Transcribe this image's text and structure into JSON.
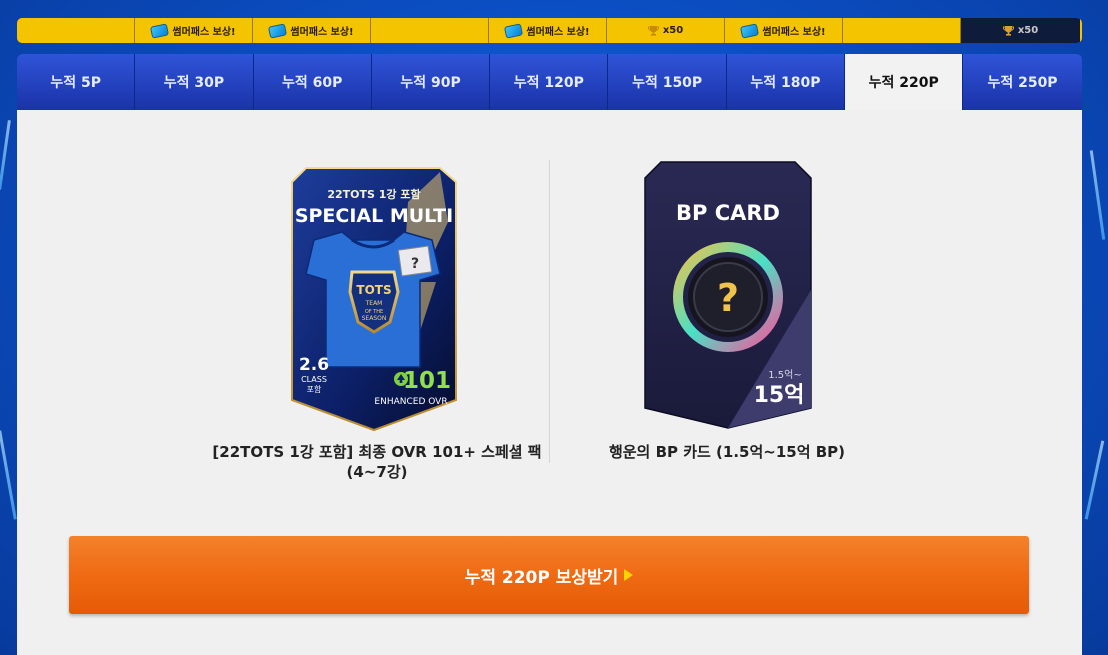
{
  "reward_strip": [
    {
      "type": "empty",
      "label": ""
    },
    {
      "type": "ticket",
      "label": "썸머패스 보상!"
    },
    {
      "type": "ticket",
      "label": "썸머패스 보상!"
    },
    {
      "type": "empty",
      "label": ""
    },
    {
      "type": "ticket",
      "label": "썸머패스 보상!"
    },
    {
      "type": "trophy",
      "label": "x50"
    },
    {
      "type": "ticket",
      "label": "썸머패스 보상!"
    },
    {
      "type": "empty",
      "label": ""
    },
    {
      "type": "trophy",
      "label": "x50",
      "locked": true
    }
  ],
  "tabs": [
    "누적 5P",
    "누적 30P",
    "누적 60P",
    "누적 90P",
    "누적 120P",
    "누적 150P",
    "누적 180P",
    "누적 220P",
    "누적 250P"
  ],
  "active_tab": "누적 220P",
  "rewards": [
    {
      "card_texts": {
        "subtitle": "22TOTS 1강 포함",
        "title": "SPECIAL MULTI",
        "badge_top": "TOTS",
        "badge_mid": "TEAM",
        "badge_of": "OF THE",
        "badge_bottom": "SEASON",
        "season_num": "2.6",
        "season_class": "CLASS",
        "season_include": "포함",
        "ovr": "101",
        "ovr_label": "ENHANCED OVR"
      },
      "caption": "[22TOTS 1강 포함] 최종 OVR 101+ 스페셜 팩 (4~7강)"
    },
    {
      "card_texts": {
        "title": "BP CARD",
        "range_small": "1.5억~",
        "range_big": "15억"
      },
      "caption": "행운의 BP 카드 (1.5억~15억 BP)"
    }
  ],
  "claim_button": "누적 220P 보상받기",
  "colors": {
    "strip": "#f5c400",
    "tab": "#2440c0",
    "active_tab": "#f2f2f2",
    "claim": "#ef6b13"
  }
}
